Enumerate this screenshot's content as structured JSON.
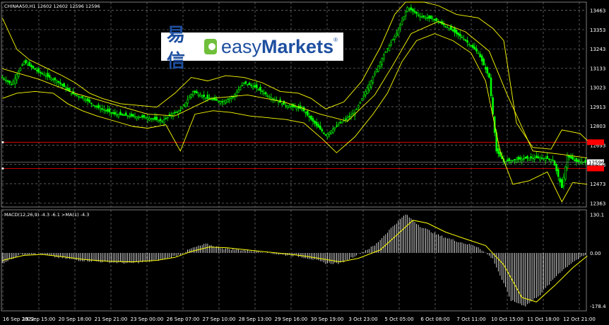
{
  "header": {
    "symbol_info": "CHINAA50,H1  12602 12602 12596 12596",
    "macd_label": "MACD(12,26,9)  -4.3  -6.1  >MA(1)  -4.3"
  },
  "logo": {
    "cn_text": "易信",
    "en_light": "easy",
    "en_bold": "Markets",
    "reg": "®"
  },
  "colors": {
    "background": "#000000",
    "grid": "#7a7a7a",
    "candle": "#00ff00",
    "band": "#ffff00",
    "hline": "#ff0000",
    "histogram": "#ffffff",
    "signal": "#ffff00",
    "axis_text": "#ffffff",
    "price_tag": "#ffffff",
    "red_tag": "#ff0000"
  },
  "chart_data": [
    {
      "type": "candlestick",
      "title": "CHINAA50,H1",
      "y_ticks": [
        13463,
        13353,
        13243,
        13133,
        13023,
        12913,
        12803,
        12693,
        12583,
        12473,
        12363
      ],
      "ylim": [
        12340,
        13510
      ],
      "x_ticks": [
        "16 Sep 2022",
        "19 Sep 15:00",
        "20 Sep 18:00",
        "21 Sep 21:00",
        "23 Sep 00:00",
        "26 Sep 07:00",
        "27 Sep 10:00",
        "28 Sep 13:00",
        "29 Sep 16:00",
        "30 Sep 19:00",
        "3 Oct 23:00",
        "5 Oct 05:00",
        "6 Oct 08:00",
        "7 Oct 11:00",
        "10 Oct 15:00",
        "11 Oct 18:00",
        "12 Oct 21:00"
      ],
      "close_path": [
        [
          0,
          13080
        ],
        [
          5,
          13040
        ],
        [
          12,
          13170
        ],
        [
          20,
          13110
        ],
        [
          30,
          13060
        ],
        [
          38,
          12990
        ],
        [
          45,
          12960
        ],
        [
          52,
          12910
        ],
        [
          62,
          12870
        ],
        [
          70,
          12860
        ],
        [
          80,
          12850
        ],
        [
          88,
          12830
        ],
        [
          93,
          12870
        ],
        [
          98,
          12890
        ],
        [
          105,
          13000
        ],
        [
          113,
          12960
        ],
        [
          121,
          12940
        ],
        [
          127,
          12970
        ],
        [
          133,
          13050
        ],
        [
          140,
          13020
        ],
        [
          147,
          12970
        ],
        [
          156,
          12920
        ],
        [
          165,
          12900
        ],
        [
          170,
          12840
        ],
        [
          178,
          12750
        ],
        [
          186,
          12820
        ],
        [
          194,
          12880
        ],
        [
          202,
          13040
        ],
        [
          210,
          13210
        ],
        [
          218,
          13350
        ],
        [
          223,
          13480
        ],
        [
          230,
          13430
        ],
        [
          238,
          13410
        ],
        [
          246,
          13360
        ],
        [
          254,
          13300
        ],
        [
          262,
          13220
        ],
        [
          268,
          13080
        ],
        [
          272,
          12660
        ],
        [
          276,
          12600
        ],
        [
          283,
          12610
        ],
        [
          290,
          12620
        ],
        [
          298,
          12620
        ],
        [
          303,
          12610
        ],
        [
          308,
          12450
        ],
        [
          311,
          12630
        ],
        [
          316,
          12600
        ],
        [
          322,
          12596
        ]
      ],
      "bb_upper_path": [
        [
          0,
          13420
        ],
        [
          8,
          13240
        ],
        [
          15,
          13180
        ],
        [
          25,
          13130
        ],
        [
          33,
          13090
        ],
        [
          40,
          13050
        ],
        [
          48,
          12990
        ],
        [
          55,
          12960
        ],
        [
          65,
          12930
        ],
        [
          75,
          12920
        ],
        [
          85,
          12910
        ],
        [
          95,
          12990
        ],
        [
          104,
          13080
        ],
        [
          113,
          13060
        ],
        [
          123,
          13090
        ],
        [
          133,
          13080
        ],
        [
          143,
          13050
        ],
        [
          153,
          13000
        ],
        [
          163,
          12990
        ],
        [
          170,
          12960
        ],
        [
          178,
          12900
        ],
        [
          188,
          12940
        ],
        [
          198,
          13060
        ],
        [
          208,
          13250
        ],
        [
          216,
          13440
        ],
        [
          222,
          13510
        ],
        [
          232,
          13510
        ],
        [
          240,
          13490
        ],
        [
          250,
          13440
        ],
        [
          262,
          13420
        ],
        [
          270,
          13360
        ],
        [
          276,
          13290
        ],
        [
          283,
          12820
        ],
        [
          292,
          12680
        ],
        [
          302,
          12670
        ],
        [
          308,
          12780
        ],
        [
          318,
          12760
        ],
        [
          322,
          12720
        ]
      ],
      "bb_lower_path": [
        [
          0,
          12960
        ],
        [
          8,
          12990
        ],
        [
          18,
          13000
        ],
        [
          28,
          12990
        ],
        [
          36,
          12930
        ],
        [
          44,
          12890
        ],
        [
          52,
          12860
        ],
        [
          62,
          12830
        ],
        [
          72,
          12800
        ],
        [
          80,
          12790
        ],
        [
          90,
          12810
        ],
        [
          98,
          12660
        ],
        [
          106,
          12870
        ],
        [
          116,
          12890
        ],
        [
          126,
          12880
        ],
        [
          136,
          12860
        ],
        [
          146,
          12850
        ],
        [
          156,
          12840
        ],
        [
          166,
          12820
        ],
        [
          176,
          12730
        ],
        [
          184,
          12650
        ],
        [
          194,
          12740
        ],
        [
          204,
          12870
        ],
        [
          212,
          12990
        ],
        [
          220,
          13170
        ],
        [
          228,
          13290
        ],
        [
          238,
          13330
        ],
        [
          248,
          13290
        ],
        [
          258,
          13220
        ],
        [
          266,
          13060
        ],
        [
          274,
          12660
        ],
        [
          281,
          12470
        ],
        [
          290,
          12490
        ],
        [
          300,
          12540
        ],
        [
          308,
          12370
        ],
        [
          314,
          12480
        ],
        [
          322,
          12470
        ]
      ],
      "bb_middle_path": [
        [
          0,
          13130
        ],
        [
          20,
          13070
        ],
        [
          40,
          12990
        ],
        [
          60,
          12930
        ],
        [
          80,
          12870
        ],
        [
          95,
          12860
        ],
        [
          115,
          12960
        ],
        [
          135,
          12980
        ],
        [
          155,
          12940
        ],
        [
          175,
          12870
        ],
        [
          190,
          12830
        ],
        [
          205,
          12980
        ],
        [
          215,
          13150
        ],
        [
          225,
          13330
        ],
        [
          240,
          13400
        ],
        [
          255,
          13340
        ],
        [
          268,
          13230
        ],
        [
          278,
          12980
        ],
        [
          292,
          12660
        ],
        [
          308,
          12640
        ],
        [
          322,
          12620
        ]
      ],
      "hlines": [
        12710,
        12560
      ],
      "price_tags": [
        {
          "value": 12596,
          "label": "12596"
        }
      ],
      "red_tags": [
        12710,
        12560
      ]
    },
    {
      "type": "histogram",
      "title": "MACD(12,26,9)",
      "y_ticks": [
        130.1,
        0.0,
        -178.4
      ],
      "ylim": [
        -195,
        145
      ],
      "hist_path": [
        [
          0,
          -35
        ],
        [
          10,
          -5
        ],
        [
          20,
          -2
        ],
        [
          30,
          -15
        ],
        [
          42,
          -25
        ],
        [
          55,
          -30
        ],
        [
          70,
          -35
        ],
        [
          82,
          -28
        ],
        [
          90,
          -20
        ],
        [
          98,
          -5
        ],
        [
          104,
          15
        ],
        [
          112,
          30
        ],
        [
          122,
          15
        ],
        [
          132,
          10
        ],
        [
          142,
          5
        ],
        [
          152,
          -5
        ],
        [
          162,
          -10
        ],
        [
          170,
          -20
        ],
        [
          178,
          -35
        ],
        [
          186,
          -35
        ],
        [
          194,
          -10
        ],
        [
          205,
          25
        ],
        [
          215,
          90
        ],
        [
          222,
          130
        ],
        [
          230,
          90
        ],
        [
          240,
          60
        ],
        [
          250,
          40
        ],
        [
          262,
          20
        ],
        [
          270,
          -20
        ],
        [
          280,
          -160
        ],
        [
          288,
          -178
        ],
        [
          296,
          -140
        ],
        [
          306,
          -70
        ],
        [
          314,
          -30
        ],
        [
          322,
          -4
        ]
      ],
      "signal_path": [
        [
          0,
          -25
        ],
        [
          12,
          -8
        ],
        [
          22,
          -5
        ],
        [
          32,
          -12
        ],
        [
          45,
          -22
        ],
        [
          58,
          -28
        ],
        [
          72,
          -30
        ],
        [
          85,
          -25
        ],
        [
          95,
          -15
        ],
        [
          104,
          5
        ],
        [
          114,
          20
        ],
        [
          124,
          17
        ],
        [
          135,
          10
        ],
        [
          146,
          3
        ],
        [
          156,
          -3
        ],
        [
          166,
          -10
        ],
        [
          176,
          -20
        ],
        [
          186,
          -30
        ],
        [
          196,
          -18
        ],
        [
          208,
          10
        ],
        [
          218,
          65
        ],
        [
          226,
          110
        ],
        [
          234,
          100
        ],
        [
          244,
          70
        ],
        [
          256,
          45
        ],
        [
          266,
          25
        ],
        [
          276,
          -40
        ],
        [
          286,
          -150
        ],
        [
          294,
          -165
        ],
        [
          304,
          -110
        ],
        [
          314,
          -50
        ],
        [
          322,
          -10
        ]
      ]
    }
  ]
}
